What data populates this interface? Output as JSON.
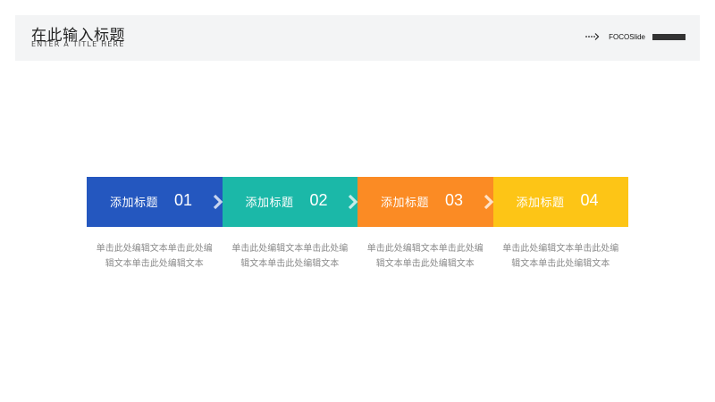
{
  "header": {
    "title": "在此输入标题",
    "subtitle": "ENTER A TITLE HERE",
    "brand": "FOCOSlide"
  },
  "steps": [
    {
      "label": "添加标题",
      "number": "01",
      "color": "#2457bf",
      "description": "单击此处编辑文本单击此处编辑文本单击此处编辑文本"
    },
    {
      "label": "添加标题",
      "number": "02",
      "color": "#1bb8a8",
      "description": "单击此处编辑文本单击此处编辑文本单击此处编辑文本"
    },
    {
      "label": "添加标题",
      "number": "03",
      "color": "#fb8b24",
      "description": "单击此处编辑文本单击此处编辑文本单击此处编辑文本"
    },
    {
      "label": "添加标题",
      "number": "04",
      "color": "#fdc516",
      "description": "单击此处编辑文本单击此处编辑文本单击此处编辑文本"
    }
  ],
  "icons": {
    "brand_arrow": "dotted-arrow-icon",
    "step_connector": "chevron-right-icon"
  }
}
